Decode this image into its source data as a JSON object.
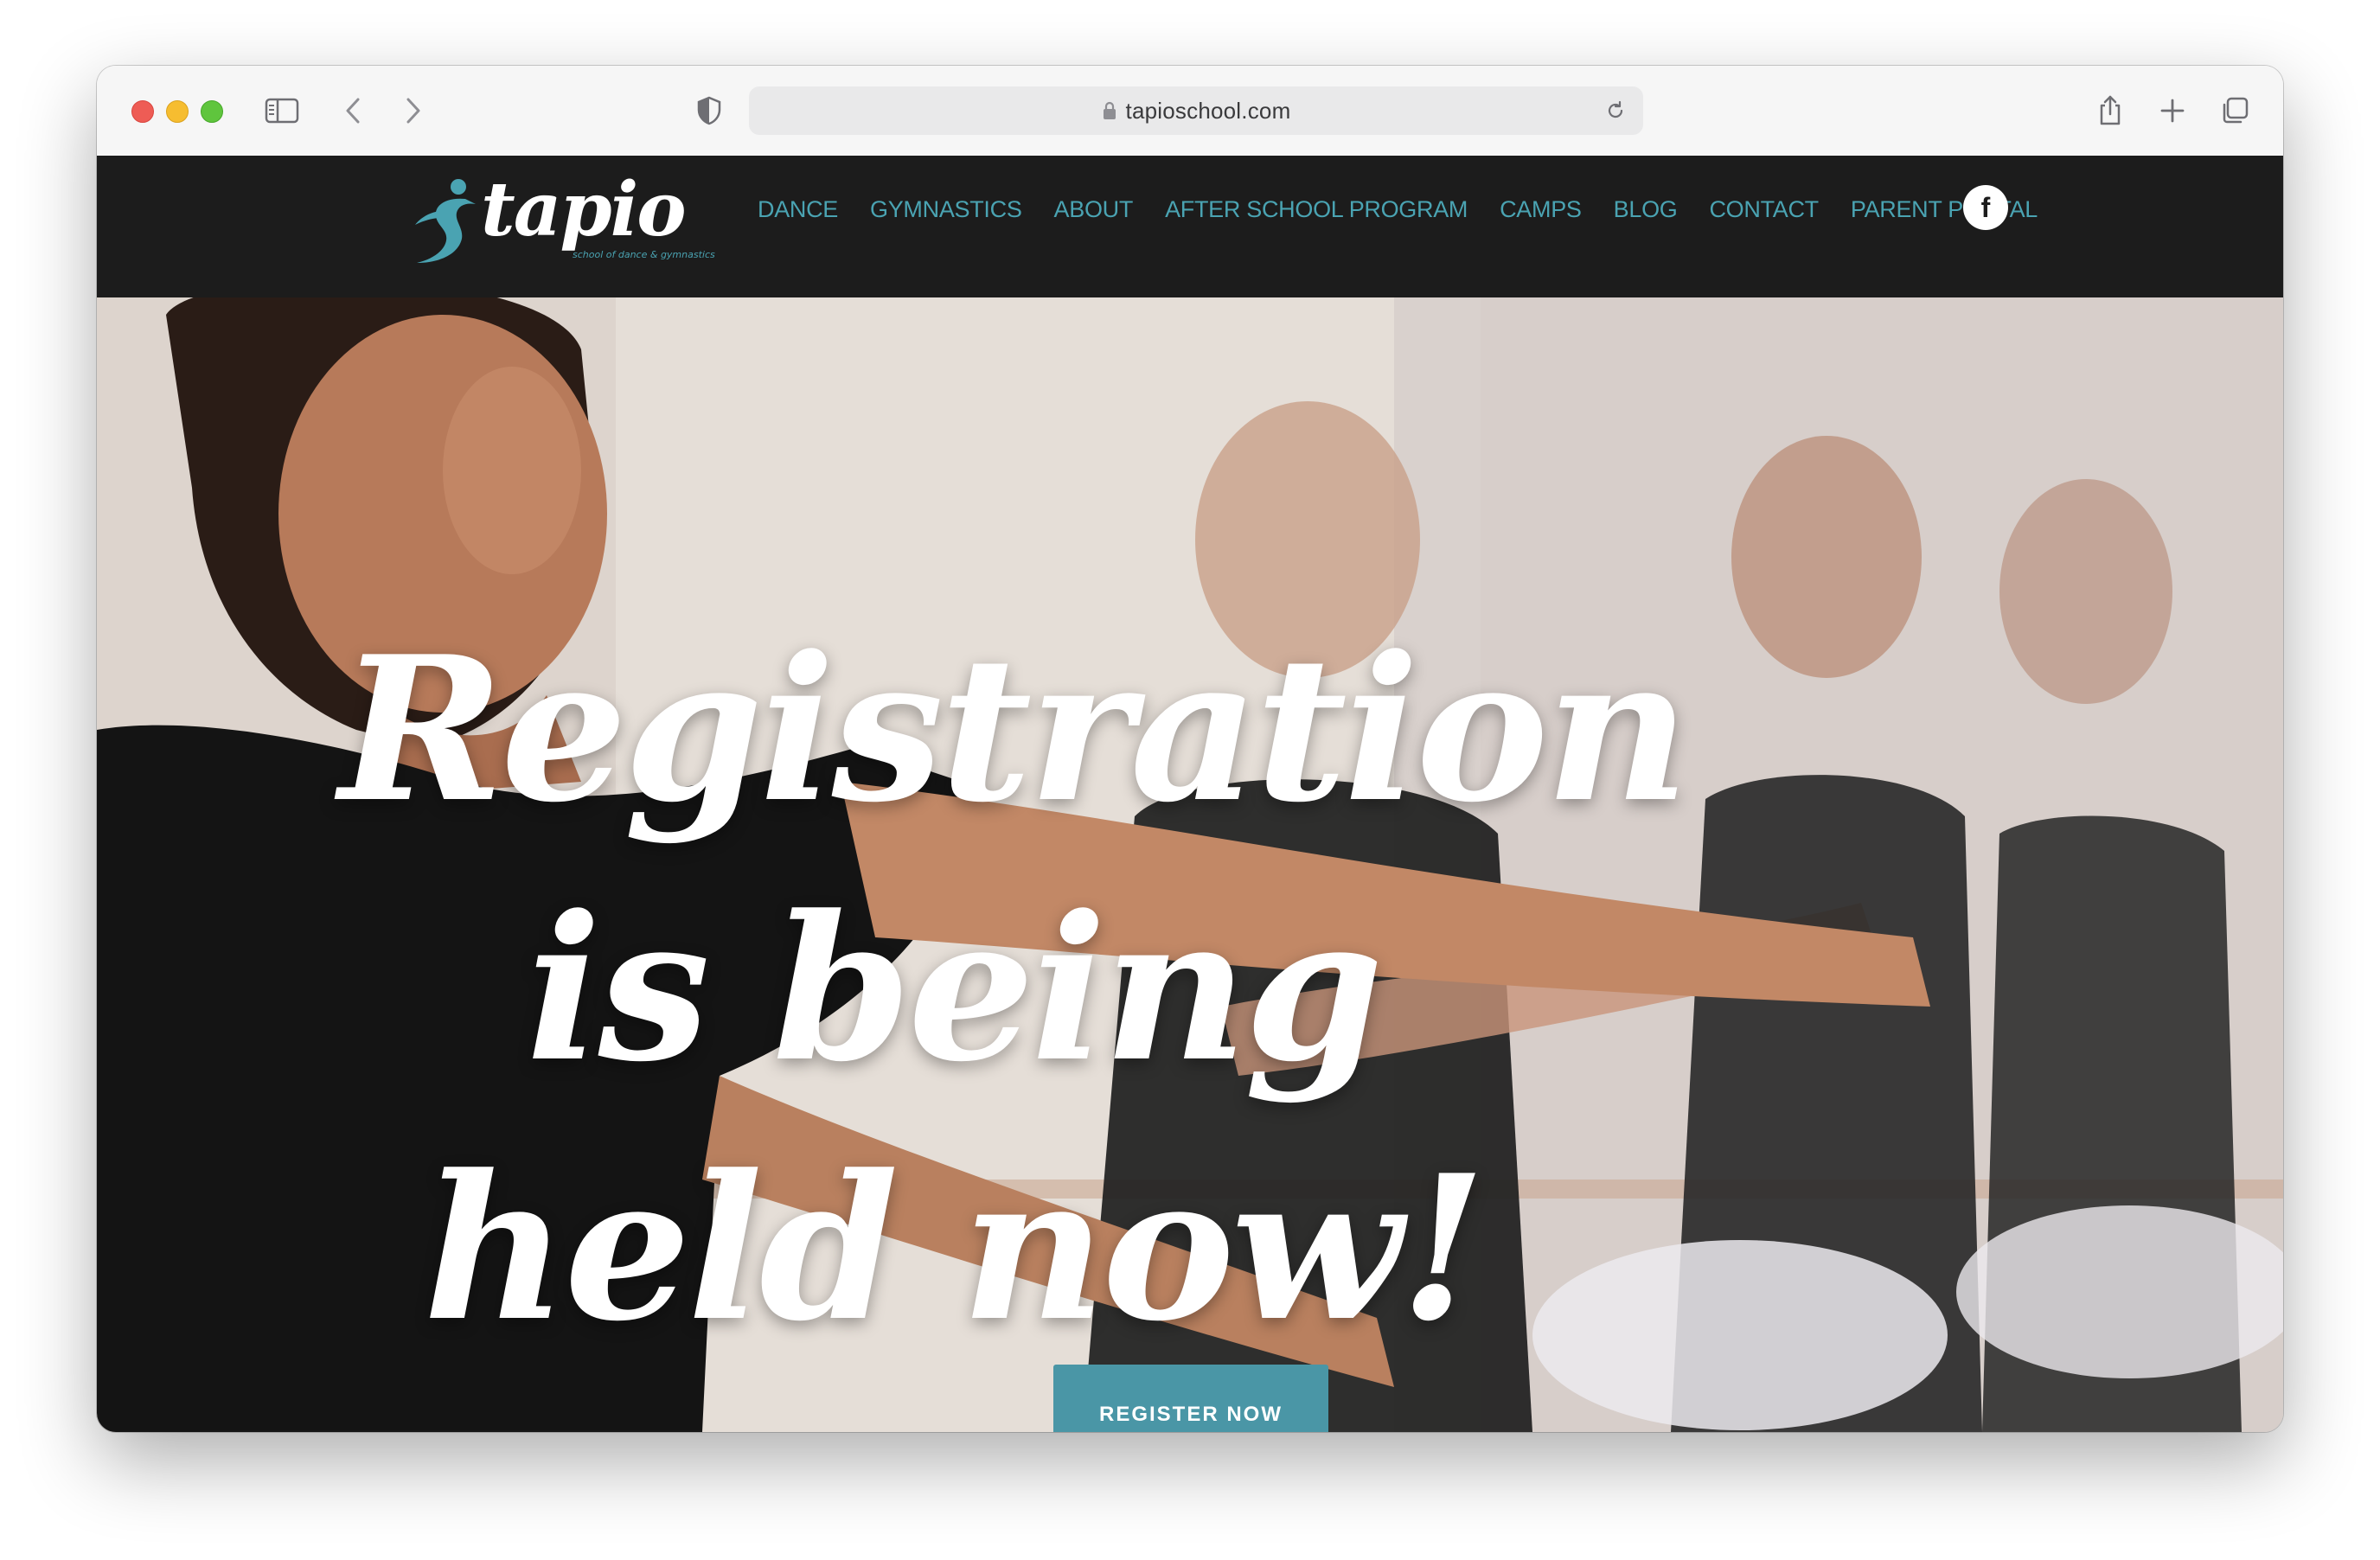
{
  "browser": {
    "url": "tapioschool.com"
  },
  "site": {
    "logo_word": "tapio",
    "logo_tagline": "school of dance & gymnastics",
    "nav": [
      {
        "label": "DANCE"
      },
      {
        "label": "GYMNASTICS"
      },
      {
        "label": "ABOUT"
      },
      {
        "label": "AFTER SCHOOL PROGRAM"
      },
      {
        "label": "CAMPS"
      },
      {
        "label": "BLOG"
      },
      {
        "label": "CONTACT"
      },
      {
        "label": "PARENT PORTAL"
      }
    ],
    "social_icon": "facebook-icon",
    "social_glyph": "f"
  },
  "hero": {
    "headline": "Registration is being held now!",
    "cta_label": "REGISTER NOW"
  },
  "colors": {
    "accent": "#4aa3b2",
    "header_bg": "#1c1c1c",
    "button_bg": "#4a96a6"
  }
}
